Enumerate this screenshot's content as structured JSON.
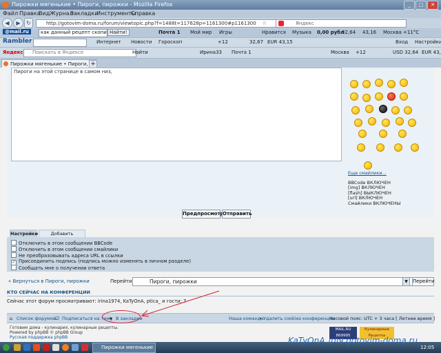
{
  "window": {
    "title": "Пирожки мягенькие • Пироги, пирожки - Mozilla Firefox",
    "min": "_",
    "max": "□",
    "close": "✕"
  },
  "menu": [
    "Файл",
    "Правка",
    "Вид",
    "Журнал",
    "Закладки",
    "Инструменты",
    "Справка"
  ],
  "nav": {
    "url": "http://gotovim-doma.ru/forum/viewtopic.php?f=1488t=117628p=1161300#p1161300",
    "search_placeholder": "Яндекс",
    "back": "◀",
    "forward": "▶",
    "reload": "↻",
    "star": "☆"
  },
  "mailru_bar": {
    "logo": "@mail.ru",
    "search_value": "как данный рецепт скопи",
    "find": "Найти!",
    "mail": "Почта 1",
    "my_world": "Мой мир",
    "games": "Игры",
    "like": "Нравится",
    "music": "Музыка",
    "rub": "0,00 рубл",
    "t1": "32,64",
    "t2": "43,16",
    "weather": "Москва +11°C"
  },
  "rambler_bar": {
    "logo": "Rambler",
    "search": "Интернет",
    "news": "Новости",
    "horo": "Гороскоп",
    "val1": "+12",
    "usd": "32,67",
    "eur": "EUR 43,15",
    "login": "Вход",
    "settings": "Настройки"
  },
  "yandex_bar": {
    "logo": "Яндекс",
    "search_placeholder": "Поискать в Яндексе",
    "find": "Найти",
    "user": "Ирина33",
    "mail": "Почта 1",
    "weather": "Москва",
    "temp": "+12",
    "usd": "USD 32,64",
    "eur": "EUR 43,15"
  },
  "tab": {
    "title": "Пирожки мягенькие • Пироги, п...",
    "new_tab": "+"
  },
  "post": {
    "textarea_text": "Пироги на этой странице в самом низ,",
    "more_smilies": "Еще смайлики...",
    "bbcode": [
      "BBCode ВКЛЮЧЕН",
      "[img] ВКЛЮЧЕН",
      "[flash] ВЫКЛЮЧЕН",
      "[url] ВКЛЮЧЕН",
      "Смайлики ВКЛЮЧЕНЫ"
    ],
    "preview": "Предпросмотр",
    "submit": "Отправить"
  },
  "options": {
    "tabs": [
      "Настройки",
      "Добавить вложения"
    ],
    "items": [
      {
        "label": "Отключить в этом сообщении BBCode",
        "checked": false
      },
      {
        "label": "Отключить в этом сообщении смайлики",
        "checked": false
      },
      {
        "label": "Не преобразовывать адреса URL в ссылки",
        "checked": false
      },
      {
        "label": "Присоединить подпись (подпись можно изменять в личном разделе)",
        "checked": true
      },
      {
        "label": "Сообщать мне о получении ответа",
        "checked": false
      }
    ]
  },
  "jump": {
    "back_link": "« Вернуться в Пироги, пирожки",
    "label": "Перейти:",
    "selected": "Пироги, пирожки",
    "go": "Перейти"
  },
  "online": {
    "title": "КТО СЕЙЧАС НА КОНФЕРЕНЦИИ",
    "text": "Сейчас этот форум просматривают: irina1974, KaTyOnA, ptica_ и гости: 7"
  },
  "forum_bar": {
    "list": "Список форумов",
    "subscribe": "Подписаться на тему",
    "bookmarks": "В закладки",
    "team": "Наша команда",
    "delete_cookies": "Удалить cookies конференции",
    "tz": "Часовой пояс: UTC + 3 часа [ Летнее время ]"
  },
  "footer": {
    "line1": "Готовим дома - кулинария, кулинарные рецепты.",
    "line2": "Powered by phpBB © phpBB Group",
    "line3": "Русская поддержка phpBB",
    "badge1": "MAIL.RU 869995",
    "badge2": "Кулинарные Рецепты"
  },
  "taskbar": {
    "item": "Пирожки мягенькие",
    "clock": "12:05"
  },
  "watermark": "KaTyOnA для gotovim-doma.ru"
}
